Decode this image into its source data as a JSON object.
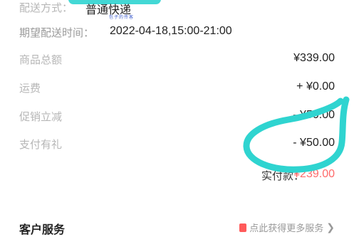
{
  "delivery": {
    "method_label": "配送方式：",
    "method_value": "普通快递",
    "watermark": "包子的传客"
  },
  "expected_time": {
    "label": "期望配送时间：",
    "value": "2022-04-18,15:00-21:00"
  },
  "summary": {
    "rows": [
      {
        "label": "商品总额",
        "value": "¥339.00"
      },
      {
        "label": "运费",
        "value": "+ ¥0.00"
      },
      {
        "label": "促销立减",
        "value": "- ¥50.00"
      },
      {
        "label": "支付有礼",
        "value": "- ¥50.00"
      }
    ]
  },
  "total": {
    "label": "实付款：",
    "value": "¥239.00"
  },
  "customer_service": {
    "title": "客户服务",
    "link_text": "点此获得更多服务"
  },
  "colors": {
    "annotation": "#2fd4d0",
    "price_accent": "#ff6a6a"
  },
  "icons": {
    "service": "service-doc-icon",
    "chevron": "chevron-right-icon"
  }
}
